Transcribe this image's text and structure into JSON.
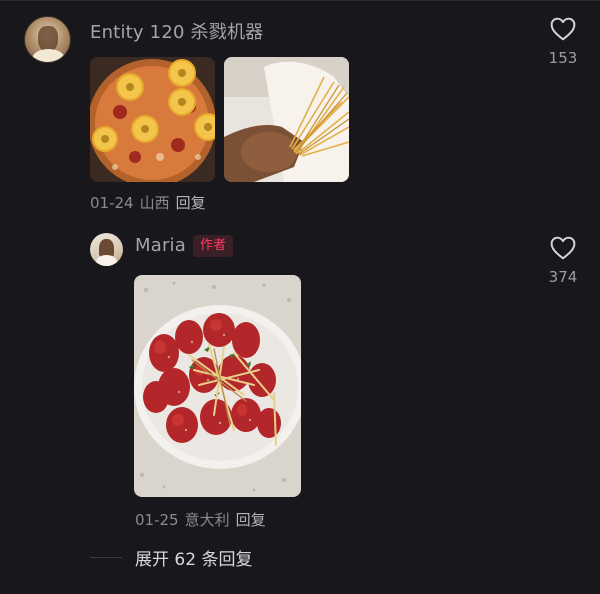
{
  "comments": [
    {
      "username": "Entity 120 杀戮机器",
      "likes": "153",
      "date": "01-24",
      "location": "山西",
      "reply_label": "回复",
      "images": [
        "pizza-photo",
        "pasta-photo"
      ]
    },
    {
      "username": "Maria",
      "author_tag": "作者",
      "likes": "374",
      "date": "01-25",
      "location": "意大利",
      "reply_label": "回复",
      "images": [
        "strawberry-photo"
      ]
    }
  ],
  "expand_replies": "展开 62 条回复",
  "icons": {
    "like": "heart-outline-icon"
  },
  "colors": {
    "background": "#17171c",
    "author_tag_text": "#ff3d60",
    "author_tag_bg": "#3a1f26",
    "secondary_text": "#8a8a92"
  }
}
